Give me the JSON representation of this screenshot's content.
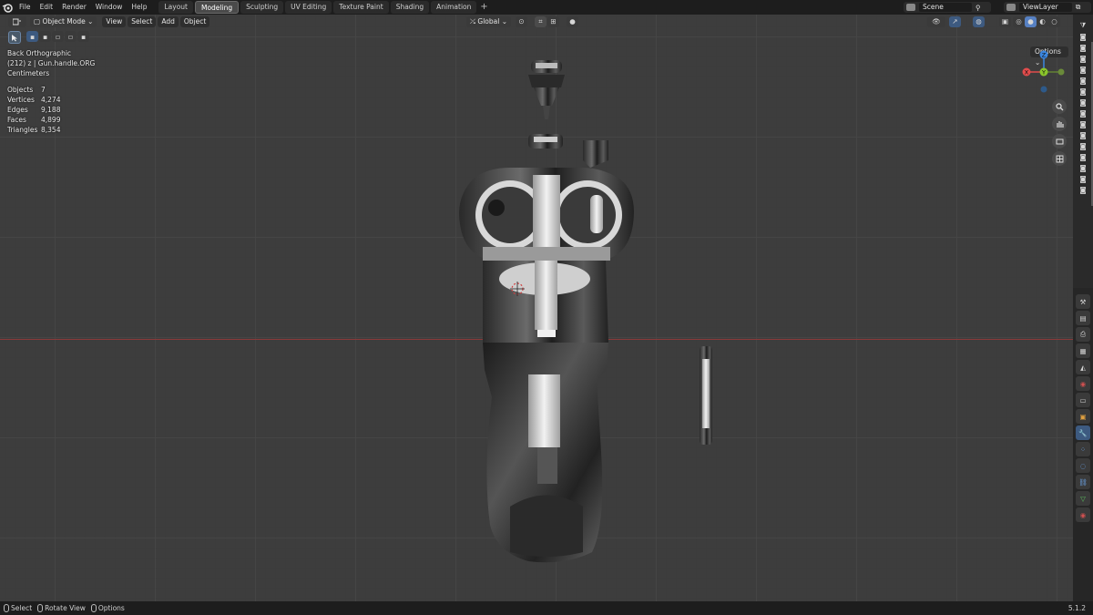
{
  "menubar": {
    "items": [
      "File",
      "Edit",
      "Render",
      "Window",
      "Help"
    ],
    "workspaces": [
      "Layout",
      "Modeling",
      "Sculpting",
      "UV Editing",
      "Texture Paint",
      "Shading",
      "Animation"
    ],
    "active_workspace": "Modeling",
    "scene": "Scene",
    "view_layer": "ViewLayer"
  },
  "viewport_header": {
    "mode": "Object Mode",
    "menus": [
      "View",
      "Select",
      "Add",
      "Object"
    ],
    "orientation": "Global",
    "options_label": "Options"
  },
  "overlay": {
    "view_name": "Back Orthographic",
    "object_line": "(212) z | Gun.handle.ORG",
    "units": "Centimeters",
    "stats": [
      {
        "label": "Objects",
        "value": "7"
      },
      {
        "label": "Vertices",
        "value": "4,274"
      },
      {
        "label": "Edges",
        "value": "9,188"
      },
      {
        "label": "Faces",
        "value": "4,899"
      },
      {
        "label": "Triangles",
        "value": "8,354"
      }
    ]
  },
  "gizmo": {
    "axes": [
      "Z",
      "X",
      "Y"
    ],
    "colors": {
      "x": "#e24c4c",
      "y": "#8ac52b",
      "z": "#3b86e0"
    }
  },
  "statusbar": {
    "items": [
      "Select",
      "Rotate View",
      "Options"
    ],
    "version": "5.1.2"
  }
}
